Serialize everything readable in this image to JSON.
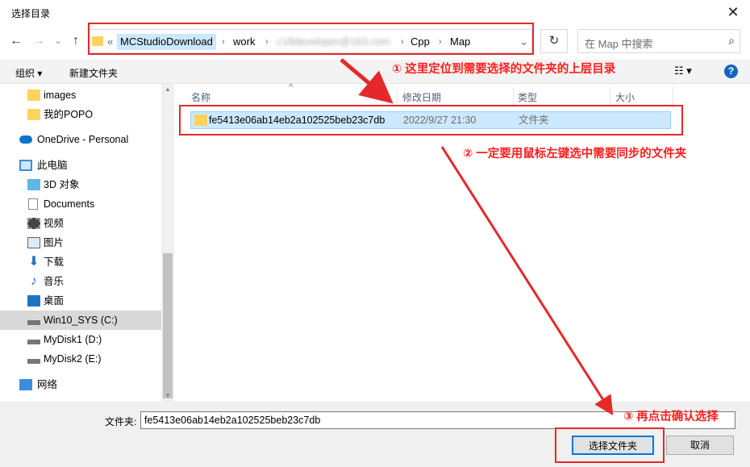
{
  "window": {
    "title": "选择目录",
    "close_glyph": "✕"
  },
  "nav": {
    "back": "←",
    "forward": "→",
    "recent": "⌄",
    "up": "↑"
  },
  "address": {
    "overflow": "«",
    "crumbs": [
      "MCStudioDownload",
      "work",
      "c18developer@163.com",
      "Cpp",
      "Map"
    ],
    "dropdown": "⌄"
  },
  "refresh_glyph": "↻",
  "search": {
    "placeholder": "在 Map 中搜索",
    "icon_glyph": "⌕"
  },
  "toolbar": {
    "organize": "组织 ▾",
    "new_folder": "新建文件夹",
    "view_glyph": "☷ ▾",
    "help_glyph": "?"
  },
  "sidebar": {
    "items": [
      {
        "label": "images",
        "icon": "folder-check-icon"
      },
      {
        "label": "我的POPO",
        "icon": "folder-icon"
      },
      {
        "label": "OneDrive - Personal",
        "icon": "cloud-icon"
      },
      {
        "label": "此电脑",
        "icon": "computer-icon"
      },
      {
        "label": "3D 对象",
        "icon": "cube-icon"
      },
      {
        "label": "Documents",
        "icon": "document-icon"
      },
      {
        "label": "视频",
        "icon": "video-icon"
      },
      {
        "label": "图片",
        "icon": "picture-icon"
      },
      {
        "label": "下载",
        "icon": "download-icon"
      },
      {
        "label": "音乐",
        "icon": "music-icon"
      },
      {
        "label": "桌面",
        "icon": "desktop-icon"
      },
      {
        "label": "Win10_SYS (C:)",
        "icon": "drive-icon"
      },
      {
        "label": "MyDisk1 (D:)",
        "icon": "drive-icon"
      },
      {
        "label": "MyDisk2 (E:)",
        "icon": "drive-icon"
      },
      {
        "label": "网络",
        "icon": "network-icon"
      }
    ]
  },
  "columns": {
    "name": "名称",
    "modified": "修改日期",
    "type": "类型",
    "size": "大小",
    "sort_glyph": "^"
  },
  "files": [
    {
      "name": "fe5413e06ab14eb2a102525beb23c7db",
      "modified": "2022/9/27 21:30",
      "type": "文件夹",
      "size": ""
    }
  ],
  "footer": {
    "folder_label": "文件夹:",
    "folder_value": "fe5413e06ab14eb2a102525beb23c7db",
    "select_button": "选择文件夹",
    "cancel_button": "取消"
  },
  "annotations": {
    "step1": "① 这里定位到需要选择的文件夹的上层目录",
    "step2": "② 一定要用鼠标左键选中需要同步的文件夹",
    "step3": "③ 再点击确认选择"
  },
  "colors": {
    "annotation": "#e5292a",
    "selection": "#cce8ff",
    "accent": "#0078d7"
  }
}
